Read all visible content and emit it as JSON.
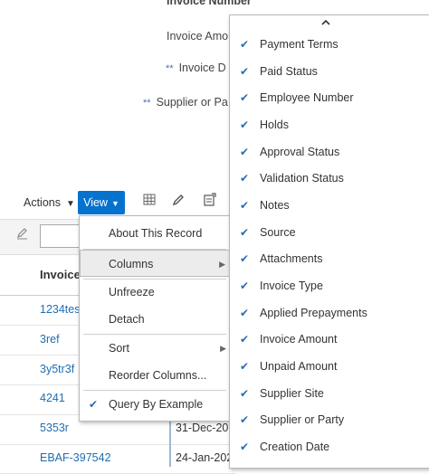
{
  "form": {
    "invoice_number": "Invoice Number",
    "invoice_amount": "Invoice Amo",
    "invoice_date": "Invoice D",
    "supplier": "Supplier or Pa",
    "required_marker": "**"
  },
  "toolbar": {
    "actions_label": "Actions",
    "view_label": "View",
    "icons": [
      "freeze-columns-icon",
      "edit-icon",
      "export-icon"
    ]
  },
  "table": {
    "header": "Invoice",
    "rows": [
      {
        "number": "1234tes",
        "date": ""
      },
      {
        "number": "3ref",
        "date": ""
      },
      {
        "number": "3y5tr3f",
        "date": ""
      },
      {
        "number": "4241",
        "date": ""
      },
      {
        "number": "5353r",
        "date": "31-Dec-202"
      },
      {
        "number": "EBAF-397542",
        "date": "24-Jan-202"
      }
    ]
  },
  "view_menu": {
    "items": [
      {
        "label": "About This Record"
      },
      {
        "label": "Columns"
      },
      {
        "label": "Unfreeze"
      },
      {
        "label": "Detach"
      },
      {
        "label": "Sort"
      },
      {
        "label": "Reorder Columns..."
      },
      {
        "label": "Query By Example",
        "checked": true
      }
    ]
  },
  "columns_menu": {
    "scroll_up_icon": "chevron-up-icon",
    "items": [
      {
        "label": "Payment Terms",
        "checked": true
      },
      {
        "label": "Paid Status",
        "checked": true
      },
      {
        "label": "Employee Number",
        "checked": true
      },
      {
        "label": "Holds",
        "checked": true
      },
      {
        "label": "Approval Status",
        "checked": true
      },
      {
        "label": "Validation Status",
        "checked": true
      },
      {
        "label": "Notes",
        "checked": true
      },
      {
        "label": "Source",
        "checked": true
      },
      {
        "label": "Attachments",
        "checked": true
      },
      {
        "label": "Invoice Type",
        "checked": true
      },
      {
        "label": "Applied Prepayments",
        "checked": true
      },
      {
        "label": "Invoice Amount",
        "checked": true
      },
      {
        "label": "Unpaid Amount",
        "checked": true
      },
      {
        "label": "Supplier Site",
        "checked": true
      },
      {
        "label": "Supplier or Party",
        "checked": true
      },
      {
        "label": "Creation Date",
        "checked": true
      }
    ]
  },
  "colors": {
    "accent": "#0572ce",
    "link": "#1f6db3",
    "check": "#2b6cb0"
  }
}
